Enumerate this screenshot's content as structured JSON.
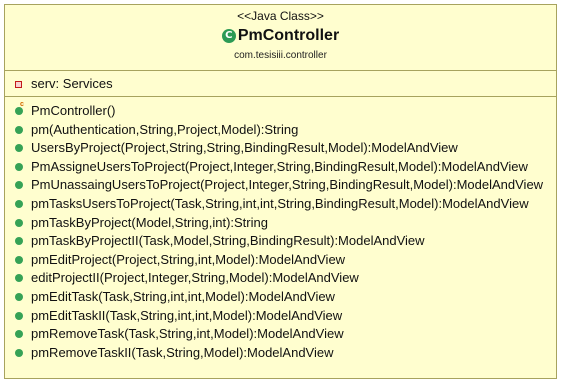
{
  "class": {
    "stereotype": "<<Java Class>>",
    "icon": "class-c-icon",
    "icon_glyph": "C",
    "name": "PmController",
    "package": "com.tesisiii.controller"
  },
  "attributes": [
    {
      "visibility": "private",
      "icon": "private-field-icon",
      "text": "serv: Services"
    }
  ],
  "operations": [
    {
      "kind": "constructor",
      "text": "PmController()"
    },
    {
      "kind": "public",
      "text": "pm(Authentication,String,Project,Model):String"
    },
    {
      "kind": "public",
      "text": "UsersByProject(Project,String,String,BindingResult,Model):ModelAndView"
    },
    {
      "kind": "public",
      "text": "PmAssigneUsersToProject(Project,Integer,String,BindingResult,Model):ModelAndView"
    },
    {
      "kind": "public",
      "text": "PmUnassaingUsersToProject(Project,Integer,String,BindingResult,Model):ModelAndView"
    },
    {
      "kind": "public",
      "text": "pmTasksUsersToProject(Task,String,int,int,String,BindingResult,Model):ModelAndView"
    },
    {
      "kind": "public",
      "text": "pmTaskByProject(Model,String,int):String"
    },
    {
      "kind": "public",
      "text": "pmTaskByProjectII(Task,Model,String,BindingResult):ModelAndView"
    },
    {
      "kind": "public",
      "text": "pmEditProject(Project,String,int,Model):ModelAndView"
    },
    {
      "kind": "public",
      "text": "editProjectII(Project,Integer,String,Model):ModelAndView"
    },
    {
      "kind": "public",
      "text": "pmEditTask(Task,String,int,int,Model):ModelAndView"
    },
    {
      "kind": "public",
      "text": "pmEditTaskII(Task,String,int,int,Model):ModelAndView"
    },
    {
      "kind": "public",
      "text": "pmRemoveTask(Task,String,int,Model):ModelAndView"
    },
    {
      "kind": "public",
      "text": "pmRemoveTaskII(Task,String,Model):ModelAndView"
    }
  ],
  "colors": {
    "box_fill": "#fffecf",
    "box_border": "#a7a35e",
    "public_icon": "#36a256",
    "private_icon": "#c21a1a"
  }
}
